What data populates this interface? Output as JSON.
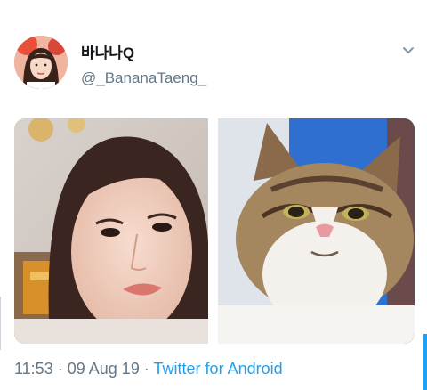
{
  "tweet": {
    "display_name": "바나나Q",
    "handle": "@_BananaTaeng_",
    "time": "11:53",
    "date": "09 Aug 19",
    "separator": "·",
    "source": "Twitter for Android"
  },
  "icons": {
    "menu": "chevron-down-icon"
  },
  "colors": {
    "link": "#1da1f2",
    "secondary_text": "#657786",
    "primary_text": "#14171a"
  }
}
